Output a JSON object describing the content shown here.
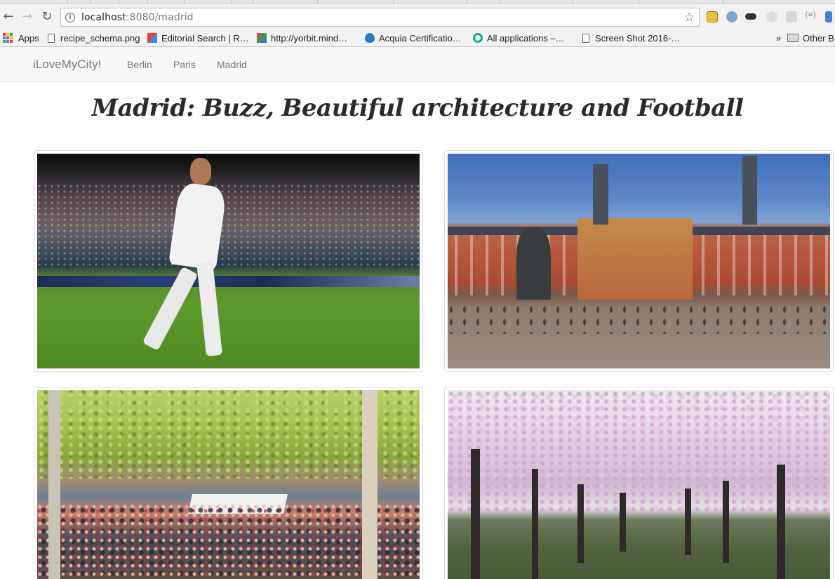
{
  "browser": {
    "url_host": "localhost",
    "url_path": ":8080/madrid",
    "bookmarks": {
      "apps": "Apps",
      "items": [
        "recipe_schema.png",
        "Editorial Search | R…",
        "http://yorbit.mind…",
        "Acquia Certificatio…",
        "All applications –…",
        "Screen Shot 2016-…"
      ],
      "overflow": "»",
      "other": "Other B"
    }
  },
  "navbar": {
    "brand": "iLoveMyCity!",
    "links": [
      "Berlin",
      "Paris",
      "Madrid"
    ]
  },
  "page": {
    "title": "Madrid: Buzz, Beautiful architecture and Football"
  },
  "photos": [
    {
      "name": "football-player-photo"
    },
    {
      "name": "plaza-mayor-photo"
    },
    {
      "name": "street-market-photo"
    },
    {
      "name": "almond-blossom-trees-photo"
    }
  ],
  "colors": {
    "navbar_bg": "#f8f8f8",
    "navbar_text": "#777777",
    "title_text": "#2b2b2b"
  }
}
